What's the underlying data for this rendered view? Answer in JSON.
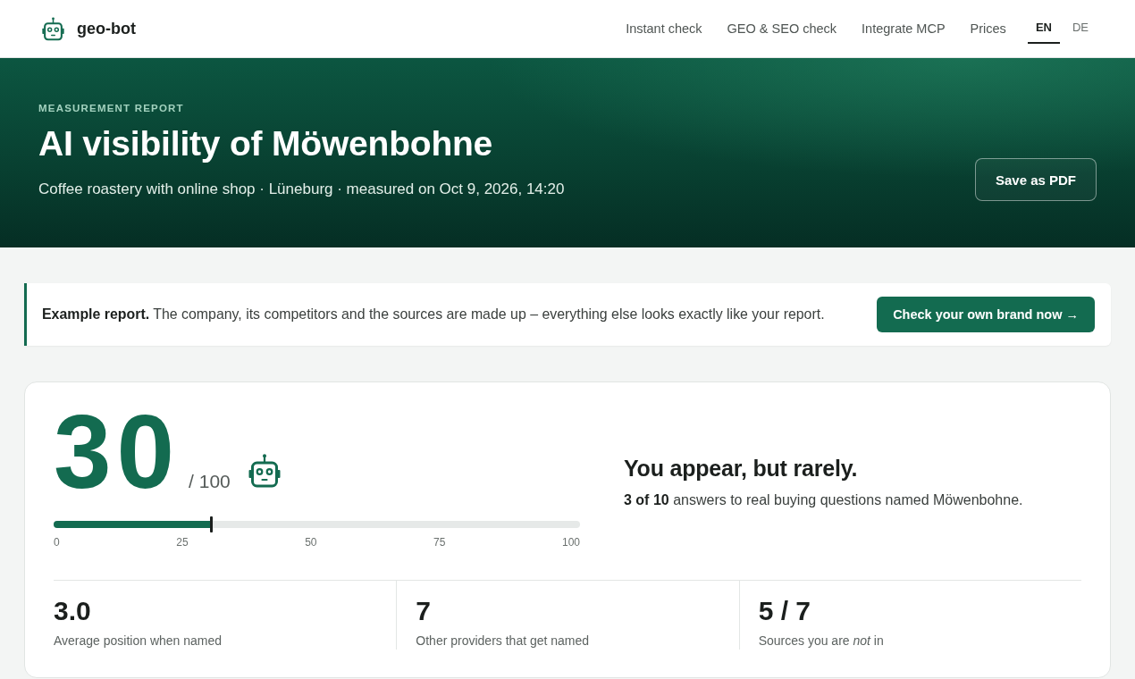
{
  "header": {
    "logo": "geo-bot",
    "nav": [
      "Instant check",
      "GEO & SEO check",
      "Integrate MCP",
      "Prices"
    ],
    "languages": [
      {
        "label": "EN",
        "selected": true
      },
      {
        "label": "DE",
        "selected": false
      }
    ]
  },
  "hero": {
    "eyebrow": "MEASUREMENT REPORT",
    "title": "AI visibility of Möwenbohne",
    "subtitle": "Coffee roastery with online shop · Lüneburg · measured on Oct 9, 2026, 14:20",
    "button": "Save as PDF"
  },
  "notice": {
    "text": "**Example report.** The company, its competitors and the sources are made up – everything else looks exactly like your report.",
    "button": "Check your own brand now →"
  },
  "score": {
    "value": "30",
    "max": "/ 100",
    "level": 0.3,
    "scale": [
      "0",
      "25",
      "50",
      "75",
      "100"
    ],
    "headline": "You appear, but rarely.",
    "summary": "**3 of 10** answers to real buying questions named Möwenbohne."
  },
  "stats": [
    {
      "value": "3.0",
      "label": "Average position when named"
    },
    {
      "value": "7",
      "label": "Other providers that get named"
    },
    {
      "value": "5 / 7",
      "label": "Sources you are *not* in"
    }
  ]
}
